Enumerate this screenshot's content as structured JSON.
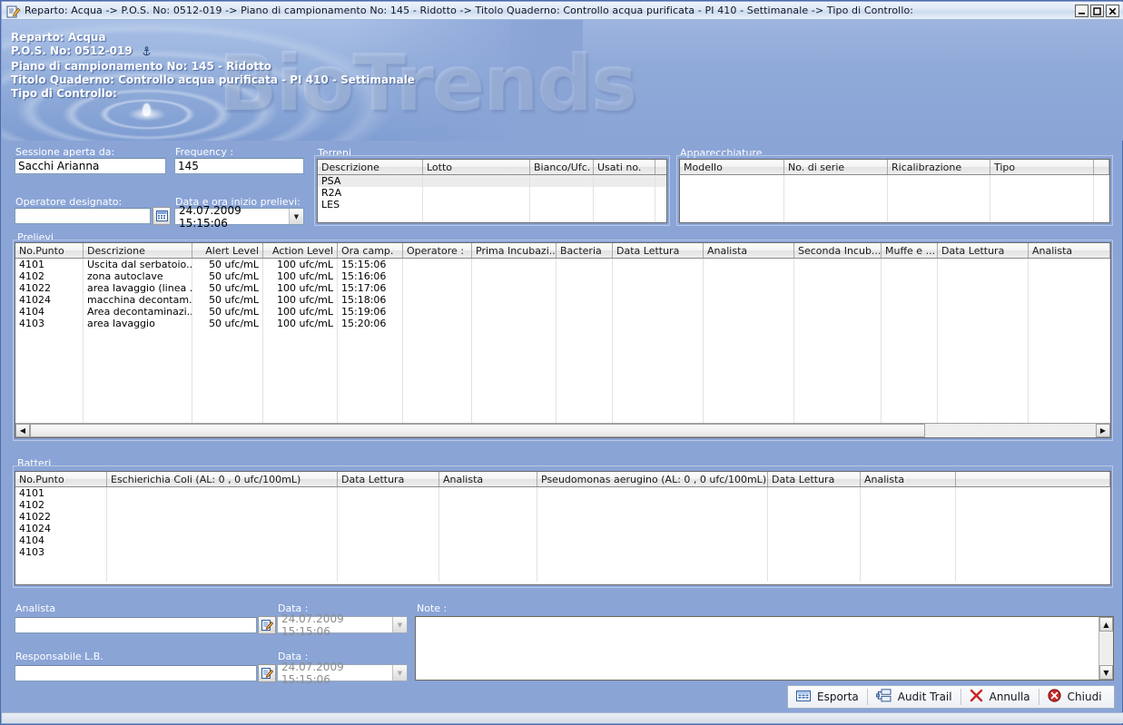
{
  "window": {
    "title": "Reparto: Acqua -> P.O.S. No: 0512-019 -> Piano di campionamento No: 145 - Ridotto -> Titolo Quaderno: Controllo acqua purificata - PI 410 - Settimanale -> Tipo di Controllo:",
    "minimize_label": "_",
    "maximize_label": "□",
    "close_label": "✕",
    "app_icon": "document-edit-icon"
  },
  "banner": {
    "watermark": "BioTrends",
    "lines": [
      "Reparto: Acqua",
      "P.O.S. No: 0512-019",
      "Piano di campionamento No: 145 - Ridotto",
      "Titolo Quaderno: Controllo acqua purificata - PI 410 - Settimanale",
      "Tipo di Controllo:"
    ],
    "anchor_icon": "anchor-icon"
  },
  "form": {
    "sessione_label": "Sessione aperta da:",
    "sessione_value": "Sacchi Arianna",
    "frequency_label": "Frequency :",
    "frequency_value": "145",
    "operatore_label": "Operatore designato:",
    "operatore_value": "",
    "operatore_picker_icon": "picker-icon",
    "data_ora_label": "Data e ora inizio prelievi:",
    "data_ora_value": "24.07.2009 15:15:06"
  },
  "terreni": {
    "title": "Terreni",
    "columns": [
      "Descrizione",
      "Lotto",
      "Bianco/Ufc.",
      "Usati no.",
      ""
    ],
    "rows": [
      [
        "PSA",
        "",
        "",
        "",
        ""
      ],
      [
        "R2A",
        "",
        "",
        "",
        ""
      ],
      [
        "LES",
        "",
        "",
        "",
        ""
      ],
      [
        "",
        "",
        "",
        "",
        ""
      ]
    ]
  },
  "apparecchiature": {
    "title": "Apparecchiature",
    "columns": [
      "Modello",
      "No. di serie",
      "Ricalibrazione",
      "Tipo",
      ""
    ],
    "rows": [
      [
        "",
        "",
        "",
        "",
        ""
      ],
      [
        "",
        "",
        "",
        "",
        ""
      ],
      [
        "",
        "",
        "",
        "",
        ""
      ],
      [
        "",
        "",
        "",
        "",
        ""
      ]
    ]
  },
  "prelievi": {
    "title": "Prelievi",
    "columns": [
      "No.Punto",
      "Descrizione",
      "Alert Level",
      "Action Level",
      "Ora camp.",
      "Operatore :",
      "Prima Incubazi...",
      "Bacteria",
      "Data Lettura",
      "Analista",
      "Seconda Incub...",
      "Muffe e ...",
      "Data Lettura",
      "Analista"
    ],
    "rows": [
      [
        "4101",
        "Uscita dal serbatoio...",
        "50 ufc/mL",
        "100 ufc/mL",
        "15:15:06",
        "",
        "",
        "",
        "",
        "",
        "",
        "",
        "",
        ""
      ],
      [
        "4102",
        "zona autoclave",
        "50 ufc/mL",
        "100 ufc/mL",
        "15:16:06",
        "",
        "",
        "",
        "",
        "",
        "",
        "",
        "",
        ""
      ],
      [
        "41022",
        "area lavaggio (linea ...",
        "50 ufc/mL",
        "100 ufc/mL",
        "15:17:06",
        "",
        "",
        "",
        "",
        "",
        "",
        "",
        "",
        ""
      ],
      [
        "41024",
        "macchina decontam...",
        "50 ufc/mL",
        "100 ufc/mL",
        "15:18:06",
        "",
        "",
        "",
        "",
        "",
        "",
        "",
        "",
        ""
      ],
      [
        "4104",
        "Area decontaminazi...",
        "50 ufc/mL",
        "100 ufc/mL",
        "15:19:06",
        "",
        "",
        "",
        "",
        "",
        "",
        "",
        "",
        ""
      ],
      [
        "4103",
        "area lavaggio",
        "50 ufc/mL",
        "100 ufc/mL",
        "15:20:06",
        "",
        "",
        "",
        "",
        "",
        "",
        "",
        "",
        ""
      ]
    ],
    "scroll_left_icon": "scroll-left-arrow",
    "scroll_right_icon": "scroll-right-arrow"
  },
  "batteri": {
    "title": "Batteri",
    "columns": [
      "No.Punto",
      "Eschierichia Coli (AL: 0 , 0 ufc/100mL)",
      "Data Lettura",
      "Analista",
      "Pseudomonas aerugino (AL: 0 , 0 ufc/100mL)",
      "Data Lettura",
      "Analista",
      ""
    ],
    "rows": [
      [
        "4101",
        "",
        "",
        "",
        "",
        "",
        "",
        ""
      ],
      [
        "4102",
        "",
        "",
        "",
        "",
        "",
        "",
        ""
      ],
      [
        "41022",
        "",
        "",
        "",
        "",
        "",
        "",
        ""
      ],
      [
        "41024",
        "",
        "",
        "",
        "",
        "",
        "",
        ""
      ],
      [
        "4104",
        "",
        "",
        "",
        "",
        "",
        "",
        ""
      ],
      [
        "4103",
        "",
        "",
        "",
        "",
        "",
        "",
        ""
      ]
    ]
  },
  "signoff": {
    "analista_label": "Analista",
    "analista_value": "",
    "analista_sign_icon": "sign-icon",
    "analista_data_label": "Data :",
    "analista_data_value": "24.07.2009 15:15:06",
    "responsabile_label": "Responsabile L.B.",
    "responsabile_value": "",
    "responsabile_sign_icon": "sign-icon",
    "responsabile_data_label": "Data :",
    "responsabile_data_value": "24.07.2009 15:15:06",
    "note_label": "Note :",
    "note_value": ""
  },
  "toolbar": {
    "esporta_label": "Esporta",
    "esporta_icon": "export-grid-icon",
    "audit_label": "Audit Trail",
    "audit_icon": "audit-trail-icon",
    "annulla_label": "Annulla",
    "annulla_icon": "red-x-icon",
    "chiudi_label": "Chiudi",
    "chiudi_icon": "close-circle-icon"
  },
  "colors": {
    "background": "#8aa4d6",
    "banner_blue": "#9db5df",
    "label_text": "#ffffff",
    "grid_bg": "#ffffff",
    "accent_red": "#cc2222"
  }
}
